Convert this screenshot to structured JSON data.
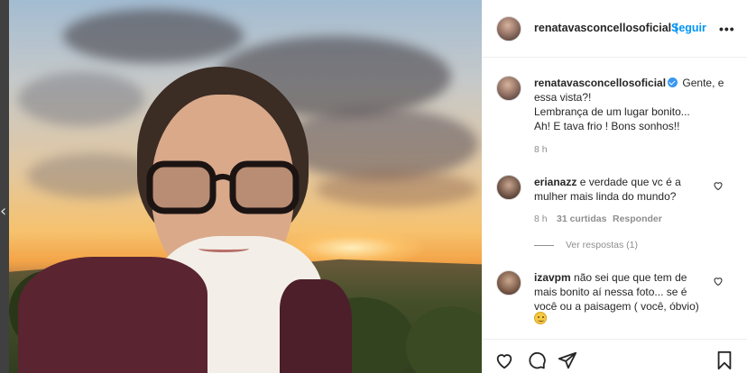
{
  "post": {
    "author": "renatavasconcellosoficial",
    "follow_label": "Seguir",
    "header_verified_mark": "(",
    "more_label": "•••",
    "caption_line1": " Gente, e",
    "caption_line2": "essa vista?!",
    "caption_line3": "Lembrança de um lugar bonito...",
    "caption_line4": "Ah! E tava frio ! Bons sonhos!!",
    "caption_time": "8 h"
  },
  "comments": [
    {
      "user": "erianazz",
      "text_line1": " e verdade que vc é a",
      "text_line2": "mulher mais linda do mundo?",
      "time": "8 h",
      "likes": "31 curtidas",
      "reply_label": "Responder",
      "view_replies": "Ver respostas (1)"
    },
    {
      "user": "izavpm",
      "text_line1": " não sei que que tem de",
      "text_line2": "mais bonito aí nessa foto... se é",
      "text_line3": "você ou a paisagem ( você, óbvio)"
    }
  ],
  "icons": {
    "left_nav": "chevron-left-icon",
    "like": "heart-icon",
    "comment": "comment-icon",
    "share": "paper-plane-icon",
    "save": "bookmark-icon",
    "emoji": "smiling-emoji-icon"
  },
  "colors": {
    "link_blue": "#0095f6",
    "verified_blue": "#3897f0",
    "text": "#262626",
    "muted": "#8e8e8e"
  }
}
